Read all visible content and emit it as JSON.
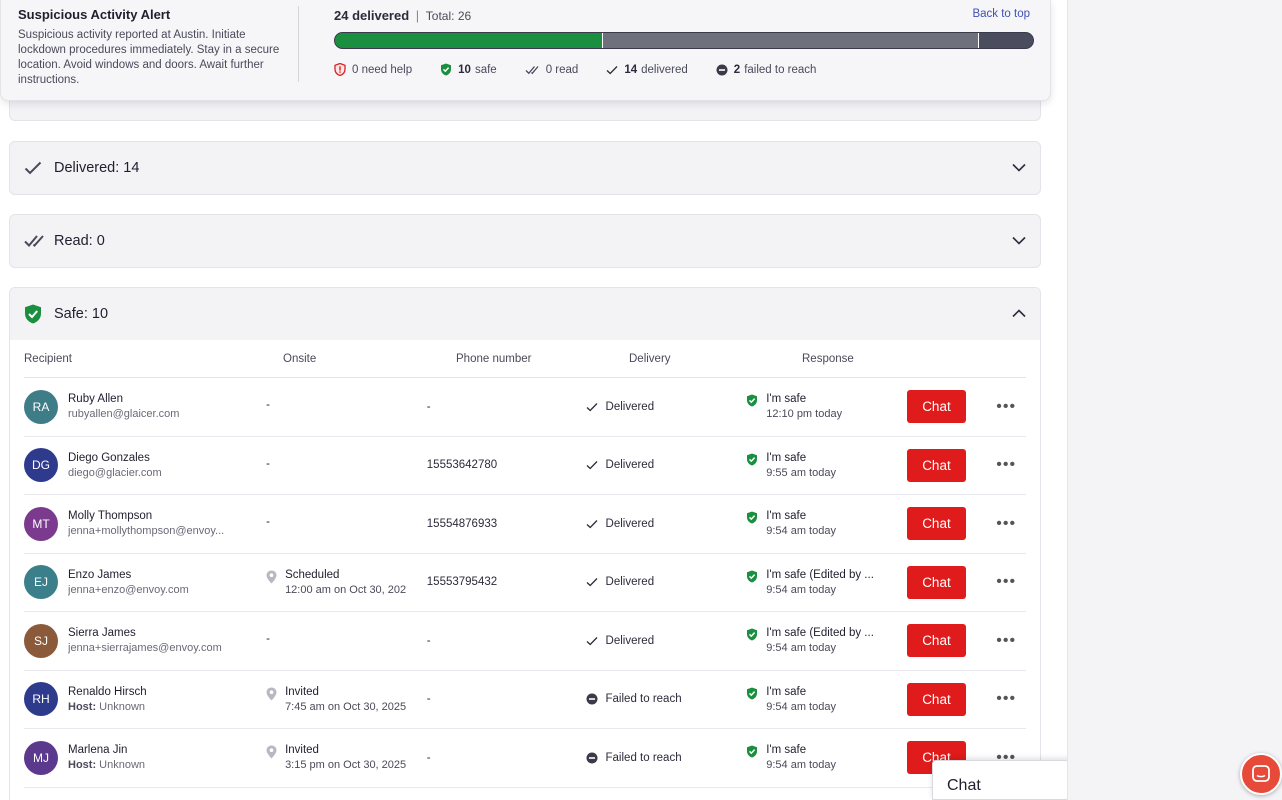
{
  "alert": {
    "title": "Suspicious Activity Alert",
    "body": "Suspicious activity reported at Austin. Initiate lockdown procedures immediately. Stay in a secure location. Avoid windows and doors. Await further instructions."
  },
  "summary": {
    "delivered_label": "24 delivered",
    "separator": "|",
    "total_label": "Total: 26",
    "back_to_top": "Back to top",
    "progress": {
      "safe": 10,
      "delivered": 14,
      "failed": 2,
      "total": 26
    },
    "legend": [
      {
        "icon": "shield-alert-icon",
        "count": "0",
        "label": "need help"
      },
      {
        "icon": "shield-check-icon",
        "count": "10",
        "label": "safe"
      },
      {
        "icon": "double-check-icon",
        "count": "0",
        "label": "read"
      },
      {
        "icon": "check-icon",
        "count": "14",
        "label": "delivered"
      },
      {
        "icon": "minus-circle-icon",
        "count": "2",
        "label": "failed to reach"
      }
    ]
  },
  "sections": {
    "delivered": {
      "label": "Delivered: 14"
    },
    "read": {
      "label": "Read: 0"
    },
    "safe": {
      "label": "Safe: 10"
    }
  },
  "table": {
    "headers": {
      "recipient": "Recipient",
      "onsite": "Onsite",
      "phone": "Phone number",
      "delivery": "Delivery",
      "response": "Response"
    },
    "chat_label": "Chat",
    "more_label": "•••",
    "rows": [
      {
        "initials": "RA",
        "avatar_color": "#3e7d87",
        "name": "Ruby Allen",
        "sub": "rubyallen@glaicer.com",
        "host": false,
        "onsite": "-",
        "onsite_time": "",
        "phone": "-",
        "delivery": "Delivered",
        "delivery_status": "delivered",
        "response": "I'm safe",
        "response_time": "12:10 pm today"
      },
      {
        "initials": "DG",
        "avatar_color": "#2e3a8c",
        "name": "Diego Gonzales",
        "sub": "diego@glacier.com",
        "host": false,
        "onsite": "-",
        "onsite_time": "",
        "phone": "15553642780",
        "delivery": "Delivered",
        "delivery_status": "delivered",
        "response": "I'm safe",
        "response_time": "9:55 am today"
      },
      {
        "initials": "MT",
        "avatar_color": "#7b3a8e",
        "name": "Molly Thompson",
        "sub": "jenna+mollythompson@envoy...",
        "host": false,
        "onsite": "-",
        "onsite_time": "",
        "phone": "15554876933",
        "delivery": "Delivered",
        "delivery_status": "delivered",
        "response": "I'm safe",
        "response_time": "9:54 am today"
      },
      {
        "initials": "EJ",
        "avatar_color": "#3a7f8a",
        "name": "Enzo James",
        "sub": "jenna+enzo@envoy.com",
        "host": false,
        "onsite": "Scheduled",
        "onsite_time": "12:00 am on Oct 30, 202",
        "phone": "15553795432",
        "delivery": "Delivered",
        "delivery_status": "delivered",
        "response": "I'm safe (Edited by ...",
        "response_time": "9:54 am today"
      },
      {
        "initials": "SJ",
        "avatar_color": "#8a5a3a",
        "name": "Sierra James",
        "sub": "jenna+sierrajames@envoy.com",
        "host": false,
        "onsite": "-",
        "onsite_time": "",
        "phone": "-",
        "delivery": "Delivered",
        "delivery_status": "delivered",
        "response": "I'm safe (Edited by ...",
        "response_time": "9:54 am today"
      },
      {
        "initials": "RH",
        "avatar_color": "#2e3a8c",
        "name": "Renaldo Hirsch",
        "sub_label": "Host:",
        "sub": "Unknown",
        "host": true,
        "onsite": "Invited",
        "onsite_time": "7:45 am on Oct 30, 2025",
        "phone": "-",
        "delivery": "Failed to reach",
        "delivery_status": "failed",
        "response": "I'm safe",
        "response_time": "9:54 am today"
      },
      {
        "initials": "MJ",
        "avatar_color": "#5b3a8e",
        "name": "Marlena Jin",
        "sub_label": "Host:",
        "sub": "Unknown",
        "host": true,
        "onsite": "Invited",
        "onsite_time": "3:15 pm on Oct 30, 2025",
        "phone": "-",
        "delivery": "Failed to reach",
        "delivery_status": "failed",
        "response": "I'm safe",
        "response_time": "9:54 am today"
      }
    ]
  },
  "chat_widget": {
    "label": "Chat"
  },
  "colors": {
    "green": "#1a8f3f",
    "red": "#e01b1b",
    "link": "#3f51b5"
  }
}
